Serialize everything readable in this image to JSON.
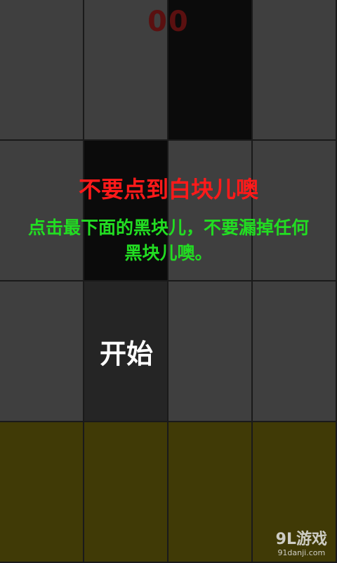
{
  "score": "00",
  "title": "不要点到白块儿噢",
  "description_line1": "点击最下面的黑块儿，不要漏掉任何",
  "description_line2": "黑块儿噢。",
  "start_button_label": "开始",
  "watermark": {
    "main": "9L游戏",
    "sub": "91danji.com"
  },
  "board": {
    "rows": [
      [
        "gray",
        "gray",
        "black",
        "gray"
      ],
      [
        "gray",
        "black",
        "gray",
        "gray"
      ],
      [
        "gray",
        "start",
        "gray",
        "gray"
      ],
      [
        "olive",
        "olive",
        "olive",
        "olive"
      ]
    ]
  },
  "colors": {
    "gray": "#3f3f3f",
    "black": "#0b0b0b",
    "start": "#252525",
    "olive": "#403a06",
    "score": "#5a1010",
    "title": "#ff1a1a",
    "description": "#22dd22",
    "start_label": "#ffffff"
  }
}
